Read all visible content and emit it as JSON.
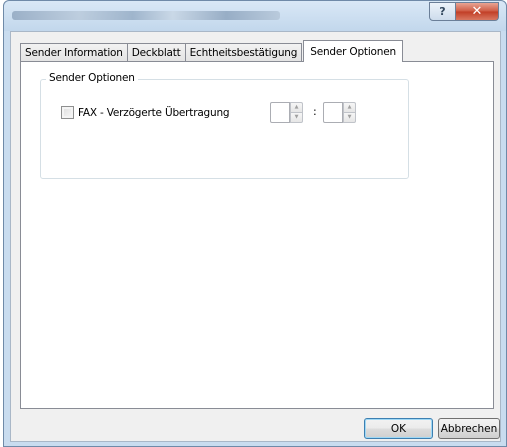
{
  "window": {
    "help_glyph": "?",
    "close_glyph": "✕"
  },
  "tabs": [
    {
      "label": "Sender Information",
      "active": false
    },
    {
      "label": "Deckblatt",
      "active": false
    },
    {
      "label": "Echtheitsbestätigung",
      "active": false
    },
    {
      "label": "Sender Optionen",
      "active": true
    }
  ],
  "group": {
    "title": "Sender Optionen",
    "checkbox_label": "FAX - Verzögerte Übertragung",
    "checkbox_checked": false,
    "hours_value": "",
    "minutes_value": "",
    "separator": ":"
  },
  "footer": {
    "ok_label": "OK",
    "cancel_label": "Abbrechen"
  },
  "icons": {
    "spin_up": "▲",
    "spin_down": "▼"
  }
}
